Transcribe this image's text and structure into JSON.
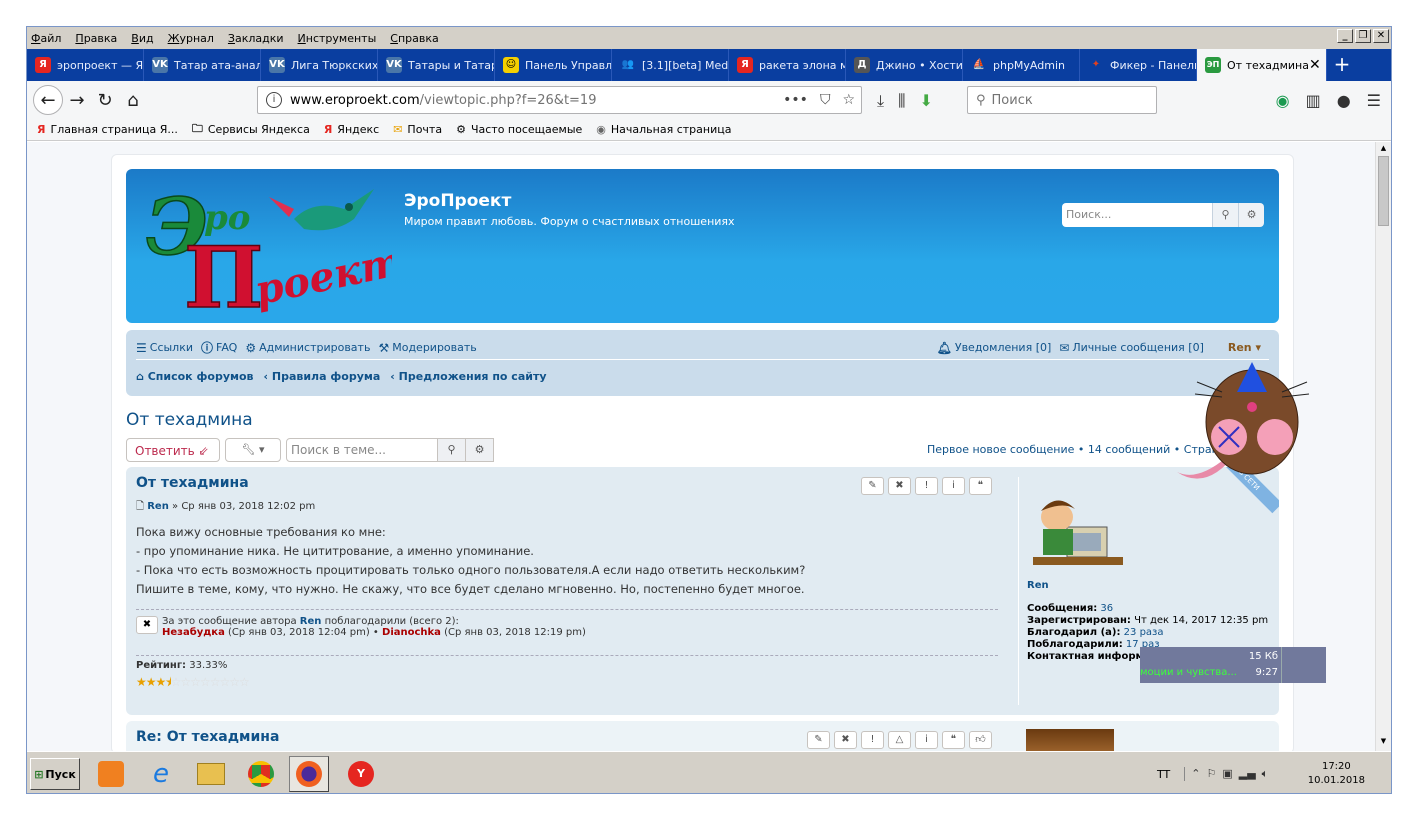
{
  "browser": {
    "menu": [
      "Файл",
      "Правка",
      "Вид",
      "Журнал",
      "Закладки",
      "Инструменты",
      "Справка"
    ],
    "tabs": [
      {
        "label": "эропроект — Ян",
        "icon": "Я",
        "color": "#e52620"
      },
      {
        "label": "Татар ата-анала",
        "icon": "vk",
        "color": "#4a76a8"
      },
      {
        "label": "Лига Тюркских",
        "icon": "vk",
        "color": "#4a76a8"
      },
      {
        "label": "Татары и Татар",
        "icon": "vk",
        "color": "#4a76a8"
      },
      {
        "label": "Панель Управле",
        "icon": "☺",
        "color": "#f5d000"
      },
      {
        "label": "[3.1][beta] Medal",
        "icon": "👥",
        "color": "#3a6ec0"
      },
      {
        "label": "ракета элона м",
        "icon": "Я",
        "color": "#e52620"
      },
      {
        "label": "Джино • Хостинг",
        "icon": "Д",
        "color": "#555555"
      },
      {
        "label": "phpMyAdmin",
        "icon": "⛵",
        "color": "#f08000"
      },
      {
        "label": "Фикер - Панель",
        "icon": "✦",
        "color": "#e04020"
      }
    ],
    "active_tab": {
      "label": "От техадмина",
      "icon": "ЭП"
    },
    "url_domain": "www.eroproekt.com",
    "url_path": "/viewtopic.php?f=26&t=19",
    "search_placeholder": "Поиск",
    "bookmarks": [
      {
        "icon": "Я",
        "label": "Главная страница Я..."
      },
      {
        "icon": "🗀",
        "label": "Сервисы Яндекса"
      },
      {
        "icon": "Я",
        "label": "Яндекс"
      },
      {
        "icon": "✉",
        "label": "Почта"
      },
      {
        "icon": "⚙",
        "label": "Часто посещаемые"
      },
      {
        "icon": "◉",
        "label": "Начальная страница"
      }
    ]
  },
  "site": {
    "name": "ЭроПроект",
    "description": "Миром правит любовь. Форум о счастливых отношениях",
    "search_placeholder": "Поиск...",
    "nav": {
      "links": "Ссылки",
      "faq": "FAQ",
      "admin": "Администрировать",
      "moderate": "Модерировать",
      "notifications": "Уведомления [0]",
      "messages": "Личные сообщения [0]",
      "user": "Ren ▾"
    },
    "crumbs": [
      "Список форумов",
      "Правила форума",
      "Предложения по сайту"
    ]
  },
  "topic": {
    "title": "От техадмина",
    "reply": "Ответить",
    "search_placeholder": "Поиск в теме...",
    "pagination": {
      "first_new": "Первое новое сообщение",
      "count": "14 сообщений",
      "page_label": "Страница",
      "page": "1",
      "of": "из",
      "total": "1"
    }
  },
  "post1": {
    "title": "От техадмина",
    "author": "Ren",
    "date": "» Ср янв 03, 2018 12:02 pm",
    "lines": [
      "Пока вижу основные требования ко мне:",
      "- про упоминание ника. Не цититрование, а именно упоминание.",
      "- Пока что есть возможность процитировать только одного пользователя.А если надо ответить нескольким?",
      "Пишите в теме, кому, что нужно. Не скажу, что все будет сделано мгновенно. Но, постепенно будет многое."
    ],
    "thanks_text_a": "За это сообщение автора",
    "thanks_author": "Ren",
    "thanks_text_b": "поблагодарили (всего 2):",
    "thanks_user1": "Незабудка",
    "thanks_date1": "(Ср янв 03, 2018 12:04 pm) •",
    "thanks_user2": "Dianochka",
    "thanks_date2": "(Ср янв 03, 2018 12:19 pm)",
    "rating_label": "Рейтинг:",
    "rating_value": "33.33%",
    "rating_stars": 0.33,
    "online": "В СЕТИ",
    "profile": {
      "name": "Ren",
      "posts_label": "Сообщения:",
      "posts": "36",
      "reg_label": "Зарегистрирован:",
      "reg": "Чт дек 14, 2017 12:35 pm",
      "thanked_label": "Благодарил (а):",
      "thanked": "23 раза",
      "got_label": "Поблагодарили:",
      "got": "17 раз",
      "contact_label": "Контактная информация:"
    }
  },
  "post2": {
    "title": "Re: От техадмина"
  },
  "notification": {
    "size": "15 Кб",
    "time": "9:27",
    "text": "моции и чувства..."
  },
  "taskbar": {
    "start": "Пуск",
    "lang": "TT",
    "time": "17:20",
    "date": "10.01.2018"
  }
}
